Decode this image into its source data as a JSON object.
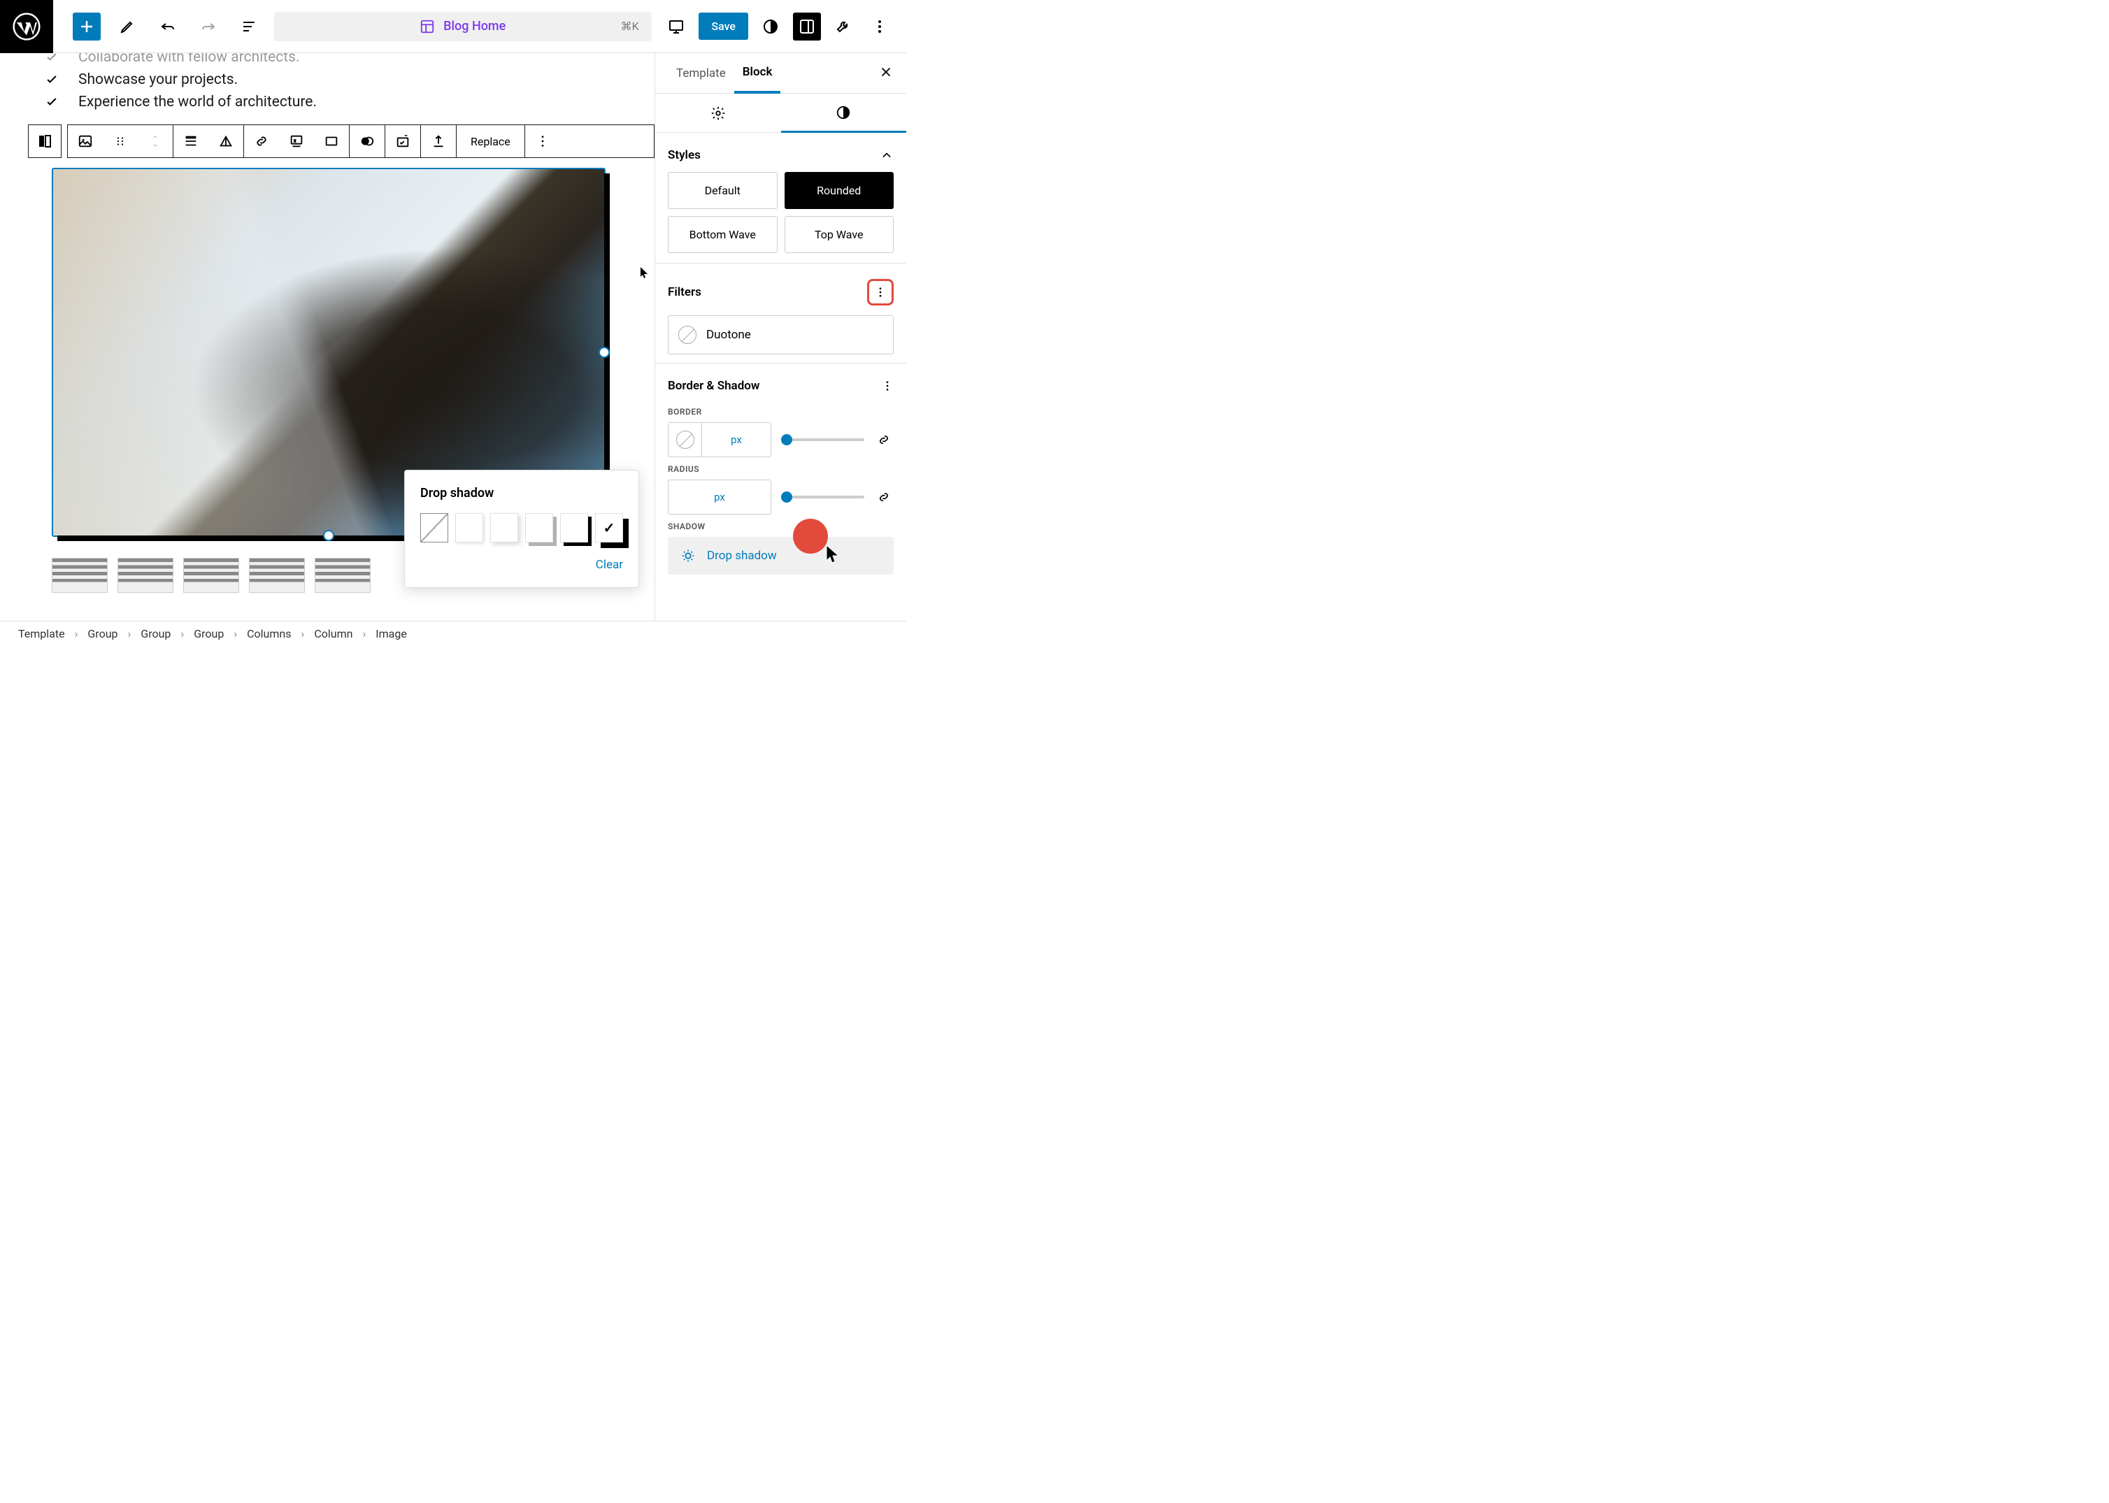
{
  "header": {
    "doc_title": "Blog Home",
    "shortcut": "⌘K",
    "save": "Save"
  },
  "checklist": [
    "Collaborate with fellow architects.",
    "Showcase your projects.",
    "Experience the world of architecture."
  ],
  "block_toolbar": {
    "replace": "Replace"
  },
  "popover": {
    "title": "Drop shadow",
    "clear": "Clear"
  },
  "sidebar": {
    "tabs": {
      "template": "Template",
      "block": "Block"
    },
    "styles": {
      "title": "Styles",
      "options": [
        "Default",
        "Rounded",
        "Bottom Wave",
        "Top Wave"
      ],
      "active": "Rounded"
    },
    "filters": {
      "title": "Filters",
      "duotone": "Duotone"
    },
    "border_shadow": {
      "title": "Border & Shadow",
      "border_label": "BORDER",
      "radius_label": "RADIUS",
      "shadow_label": "SHADOW",
      "unit": "px",
      "drop_shadow": "Drop shadow"
    }
  },
  "breadcrumb": [
    "Template",
    "Group",
    "Group",
    "Group",
    "Columns",
    "Column",
    "Image"
  ]
}
